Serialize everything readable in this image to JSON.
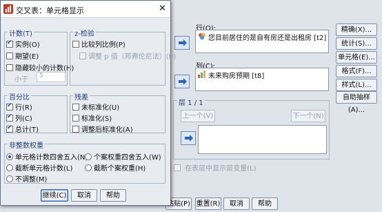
{
  "main": {
    "row_label": "行(O):",
    "row_item": "您目前居住的是自有房还是出租房 [t2]",
    "col_label": "列(C):",
    "col_item": "未来购房预期 [t8]",
    "layer_label": "层 1 / 1",
    "prev_label": "上一个(V)",
    "next_label": "下一个(N)",
    "show_layer_label": "在表层中显示层变量(L)",
    "side_buttons": [
      "精确(X)...",
      "统计(S)...",
      "单元格(E)...",
      "格式(F)...",
      "样式(L)...",
      "自助抽样(A)..."
    ],
    "bottom_buttons": [
      "粘贴(P)",
      "重置(R)",
      "取消",
      "帮助"
    ]
  },
  "dialog": {
    "title": "交叉表：单元格显示",
    "close": "✕",
    "counts_title": "计数(T)",
    "counts": [
      "实例(O)",
      "期望(E)",
      "隐藏较小的计数(H)"
    ],
    "less_than_label": "小于",
    "less_than_value": "5",
    "ztest_title": "z-检验",
    "ztest_compare": "比较列比例(P)",
    "ztest_adjust": "调整 p 值（邦弗伦尼法）(B)",
    "percent_title": "百分比",
    "percents": [
      "行(R)",
      "列(C)",
      "总计(T)"
    ],
    "residual_title": "残差",
    "residuals": [
      "未标准化(U)",
      "标准化(S)",
      "调整后标准化(A)"
    ],
    "nonint_title": "非整数权重",
    "nonint_options": [
      "单元格计数四舍五入(N)",
      "个案权重四舍五入(W)",
      "截断单元格计数(L)",
      "截断个案权重(H)",
      "不调整(M)"
    ],
    "continue": "继续(C)",
    "cancel": "取消",
    "help": "帮助"
  },
  "colors": {
    "accent": "#1a4fa1",
    "dialog_bg": "#e8ebf0",
    "window_bg": "#dfe3ea"
  }
}
